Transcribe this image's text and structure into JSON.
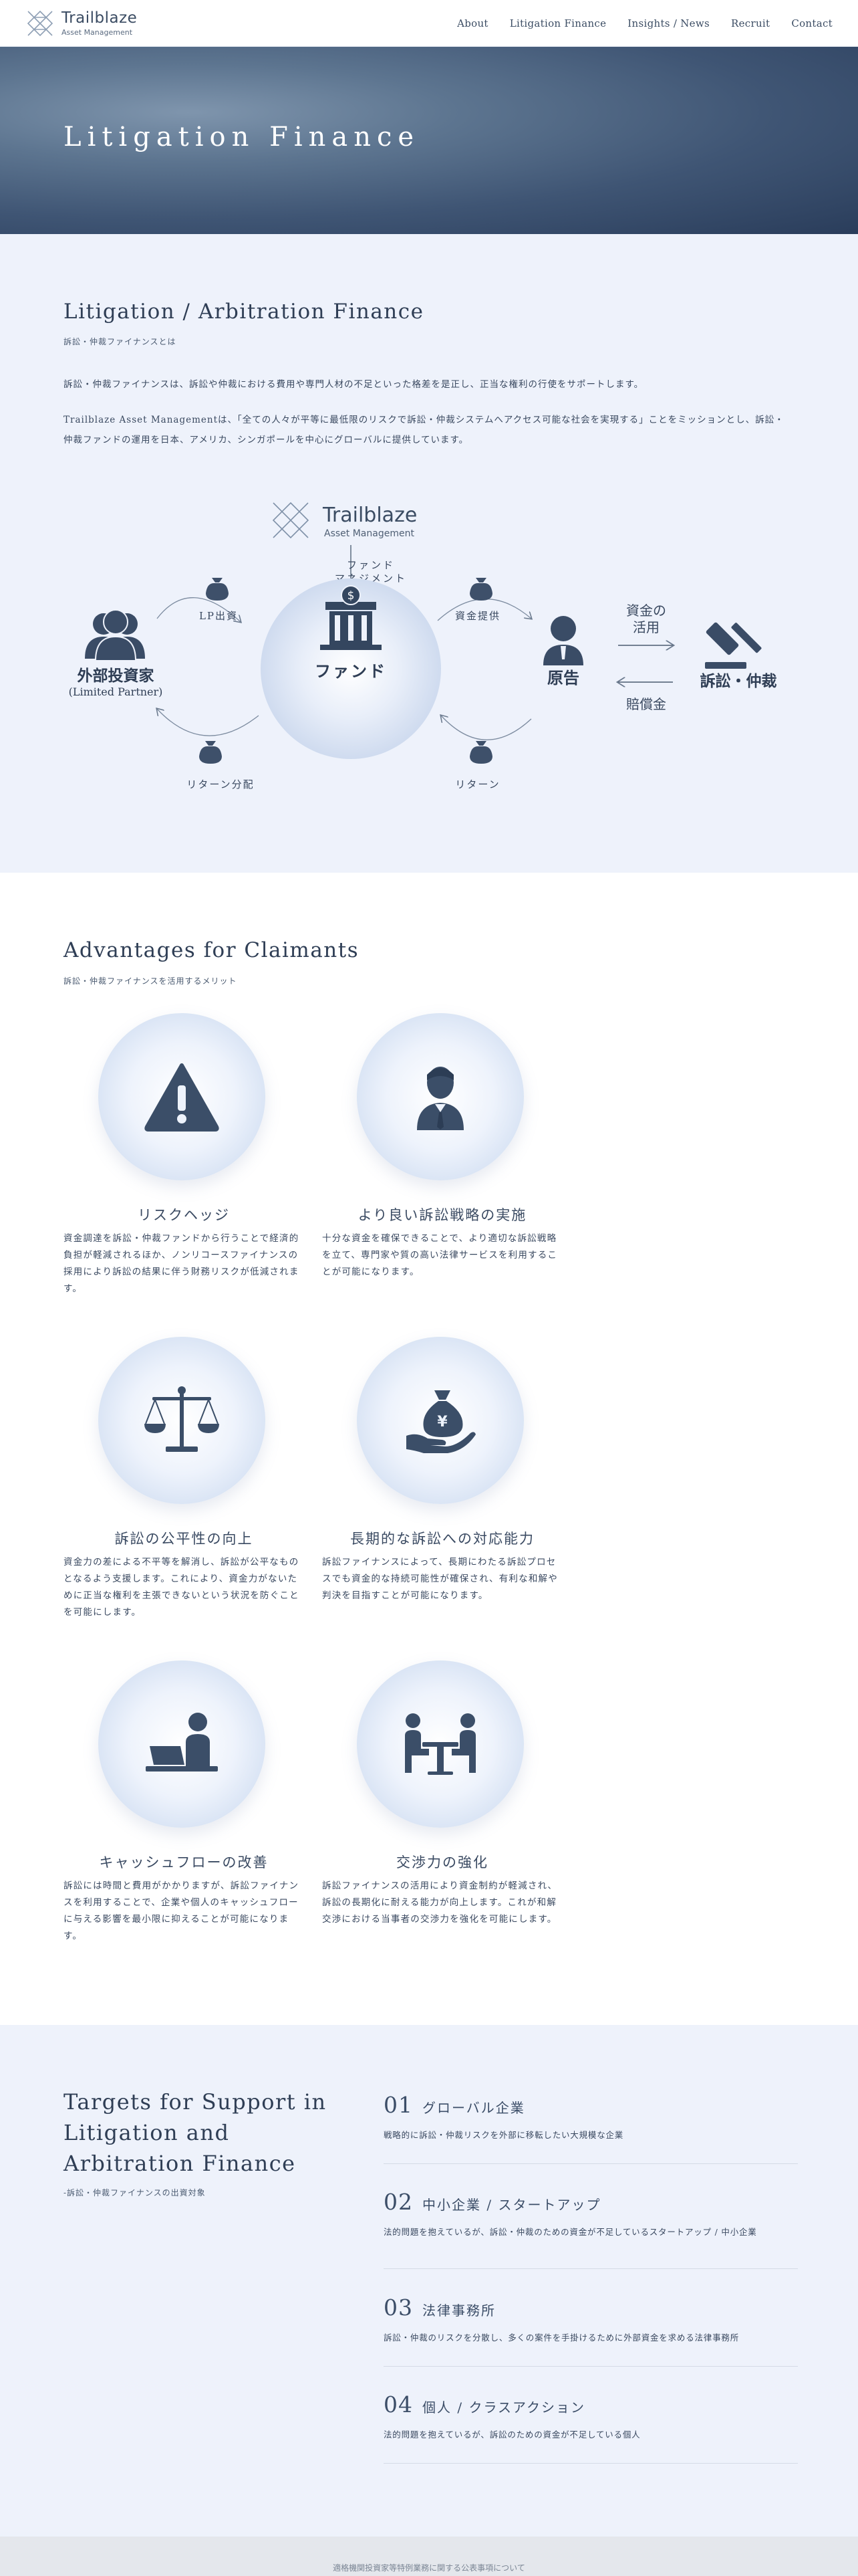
{
  "header": {
    "logo_name": "Trailblaze",
    "logo_sub": "Asset Management",
    "nav": [
      "About",
      "Litigation Finance",
      "Insights / News",
      "Recruit",
      "Contact"
    ]
  },
  "hero": {
    "title": "Litigation Finance"
  },
  "intro": {
    "title": "Litigation / Arbitration Finance",
    "subtitle": "訴訟・仲裁ファイナンスとは",
    "para1": "訴訟・仲裁ファイナンスは、訴訟や仲裁における費用や専門人材の不足といった格差を是正し、正当な権利の行使をサポートします。",
    "para2": "Trailblaze Asset Managementは、「全ての人々が平等に最低限のリスクで訴訟・仲裁システムへアクセス可能な社会を実現する」ことをミッションとし、訴訟・仲裁ファンドの運用を日本、アメリカ、シンガポールを中心にグローバルに提供しています。"
  },
  "diagram": {
    "logo_name": "Trailblaze",
    "logo_sub": "Asset Management",
    "fund_mgmt_1": "ファンド",
    "fund_mgmt_2": "マネジメント",
    "lp": "LP出資",
    "funding": "資金提供",
    "investors_1": "外部投資家",
    "investors_2": "(Limited Partner)",
    "fund": "ファンド",
    "plaintiff": "原告",
    "use_1": "資金の",
    "use_2": "活用",
    "compensation": "賠償金",
    "litigation": "訴訟・仲裁",
    "dist": "リターン分配",
    "ret": "リターン"
  },
  "advantages": {
    "title": "Advantages for Claimants",
    "subtitle": "訴訟・仲裁ファイナンスを活用するメリット",
    "items": [
      {
        "icon": "warning-icon",
        "title": "リスクヘッジ",
        "text": "資金調達を訴訟・仲裁ファンドから行うことで経済的負担が軽減されるほか、ノンリコースファイナンスの採用により訴訟の結果に伴う財務リスクが低減されます。"
      },
      {
        "icon": "lawyer-icon",
        "title": "より良い訴訟戦略の実施",
        "text": "十分な資金を確保できることで、より適切な訴訟戦略を立て、専門家や質の高い法律サービスを利用することが可能になります。"
      },
      {
        "icon": "scales-icon",
        "title": "訴訟の公平性の向上",
        "text": "資金力の差による不平等を解消し、訴訟が公平なものとなるよう支援します。これにより、資金力がないために正当な権利を主張できないという状況を防ぐことを可能にします。"
      },
      {
        "icon": "money-bag-hand-icon",
        "title": "長期的な訴訟への対応能力",
        "text": "訴訟ファイナンスによって、長期にわたる訴訟プロセスでも資金的な持続可能性が確保され、有利な和解や判決を目指すことが可能になります。"
      },
      {
        "icon": "laptop-person-icon",
        "title": "キャッシュフローの改善",
        "text": "訴訟には時間と費用がかかりますが、訴訟ファイナンスを利用することで、企業や個人のキャッシュフローに与える影響を最小限に抑えることが可能になります。"
      },
      {
        "icon": "negotiation-icon",
        "title": "交渉力の強化",
        "text": "訴訟ファイナンスの活用により資金制約が軽減され、訴訟の長期化に耐える能力が向上します。これが和解交渉における当事者の交渉力を強化を可能にします。"
      }
    ]
  },
  "targets": {
    "title": "Targets for Support in Litigation and Arbitration Finance",
    "subtitle": "-訴訟・仲裁ファイナンスの出資対象",
    "items": [
      {
        "num": "01",
        "name": "グローバル企業",
        "desc": "戦略的に訴訟・仲裁リスクを外部に移転したい大規模な企業"
      },
      {
        "num": "02",
        "name": "中小企業 / スタートアップ",
        "desc": "法的問題を抱えているが、訴訟・仲裁のための資金が不足しているスタートアップ / 中小企業"
      },
      {
        "num": "03",
        "name": "法律事務所",
        "desc": "訴訟・仲裁のリスクを分散し、多くの案件を手掛けるために外部資金を求める法律事務所"
      },
      {
        "num": "04",
        "name": "個人 / クラスアクション",
        "desc": "法的問題を抱えているが、訴訟のための資金が不足している個人"
      }
    ]
  },
  "footer": {
    "text": "適格機関投資家等特例業務に関する公表事項について"
  }
}
